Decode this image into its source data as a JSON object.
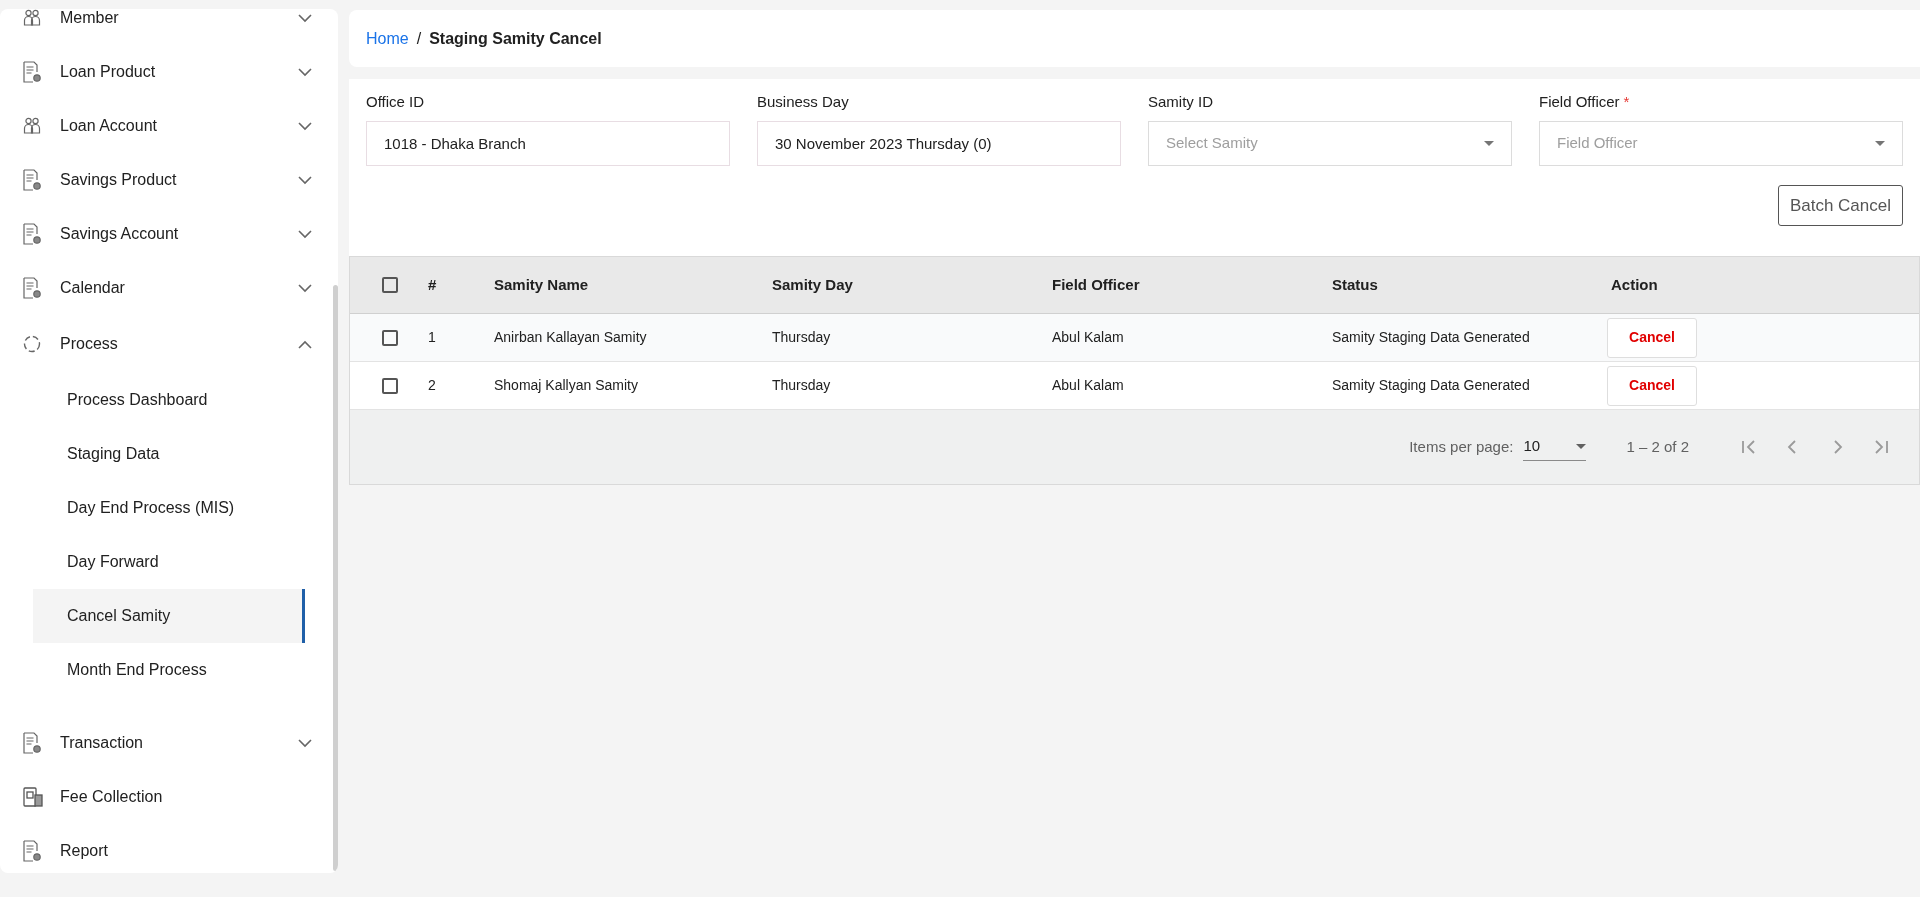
{
  "sidebar": {
    "items": [
      {
        "label": "Member",
        "kind": "people",
        "expanded": false
      },
      {
        "label": "Loan Product",
        "kind": "document",
        "expanded": false
      },
      {
        "label": "Loan Account",
        "kind": "people",
        "expanded": false
      },
      {
        "label": "Savings Product",
        "kind": "document",
        "expanded": false
      },
      {
        "label": "Savings Account",
        "kind": "document",
        "expanded": false
      },
      {
        "label": "Calendar",
        "kind": "document",
        "expanded": false
      },
      {
        "label": "Process",
        "kind": "process",
        "expanded": true,
        "children": [
          {
            "label": "Process Dashboard",
            "selected": false
          },
          {
            "label": "Staging Data",
            "selected": false
          },
          {
            "label": "Day End Process (MIS)",
            "selected": false
          },
          {
            "label": "Day Forward",
            "selected": false
          },
          {
            "label": "Cancel Samity",
            "selected": true
          },
          {
            "label": "Month End Process",
            "selected": false
          }
        ]
      },
      {
        "label": "Transaction",
        "kind": "document",
        "expanded": false
      },
      {
        "label": "Fee Collection",
        "kind": "fee"
      },
      {
        "label": "Report",
        "kind": "document"
      }
    ]
  },
  "breadcrumb": {
    "home": "Home",
    "separator": "/",
    "current": "Staging Samity Cancel"
  },
  "form": {
    "fields": [
      {
        "label": "Office ID",
        "kind": "text",
        "value": "1018 - Dhaka Branch",
        "required": false
      },
      {
        "label": "Business Day",
        "kind": "text",
        "value": "30 November 2023 Thursday (0)",
        "required": false
      },
      {
        "label": "Samity ID",
        "kind": "select",
        "placeholder": "Select Samity",
        "required": false
      },
      {
        "label": "Field Officer",
        "kind": "select",
        "placeholder": "Field Officer",
        "required": true,
        "required_mark": "*"
      }
    ],
    "batch_button": "Batch Cancel"
  },
  "table": {
    "select_all": false,
    "columns": [
      "#",
      "Samity Name",
      "Samity Day",
      "Field Officer",
      "Status",
      "Action"
    ],
    "rows": [
      {
        "checked": false,
        "cells": [
          "1",
          "Anirban Kallayan Samity",
          "Thursday",
          "Abul Kalam",
          "Samity Staging Data Generated"
        ],
        "action": "Cancel"
      },
      {
        "checked": false,
        "cells": [
          "2",
          "Shomaj Kallyan Samity",
          "Thursday",
          "Abul Kalam",
          "Samity Staging Data Generated"
        ],
        "action": "Cancel"
      }
    ]
  },
  "pagination": {
    "label": "Items per page:",
    "page_size": "10",
    "range": "1 – 2 of 2"
  }
}
